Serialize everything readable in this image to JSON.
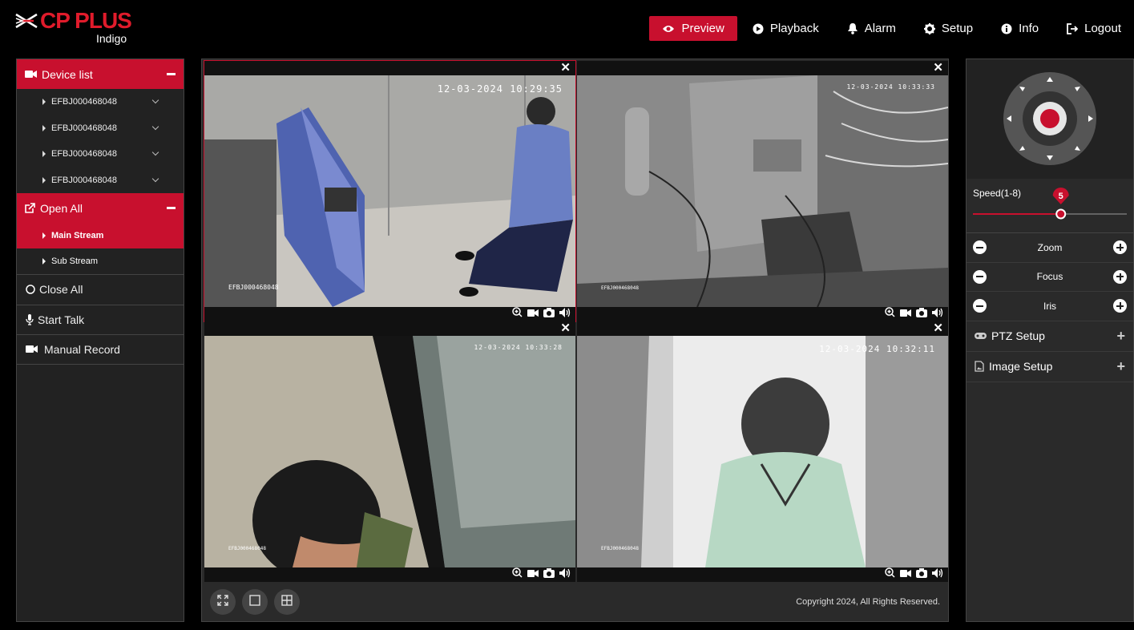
{
  "brand": {
    "name": "CP PLUS",
    "sub": "Indigo"
  },
  "nav": [
    {
      "label": "Preview",
      "icon": "eye-icon",
      "active": true
    },
    {
      "label": "Playback",
      "icon": "play-circle-icon"
    },
    {
      "label": "Alarm",
      "icon": "bell-icon"
    },
    {
      "label": "Setup",
      "icon": "gear-icon"
    },
    {
      "label": "Info",
      "icon": "info-icon"
    },
    {
      "label": "Logout",
      "icon": "logout-icon"
    }
  ],
  "sidebar": {
    "device_list_label": "Device list",
    "devices": [
      "EFBJ000468048",
      "EFBJ000468048",
      "EFBJ000468048",
      "EFBJ000468048"
    ],
    "open_all_label": "Open All",
    "streams": [
      {
        "label": "Main Stream",
        "active": true
      },
      {
        "label": "Sub Stream",
        "active": false
      }
    ],
    "close_all_label": "Close All",
    "start_talk_label": "Start Talk",
    "manual_record_label": "Manual Record"
  },
  "tiles": [
    {
      "timestamp": "12-03-2024 10:29:35",
      "camera_label": "EFBJ000468048",
      "selected": true
    },
    {
      "timestamp": "12-03-2024 10:33:33",
      "camera_label": "EFBJ000468048"
    },
    {
      "timestamp": "12-03-2024 10:33:28",
      "camera_label": "EFBJ000468048"
    },
    {
      "timestamp": "12-03-2024 10:32:11",
      "camera_label": "EFBJ000468048"
    }
  ],
  "footer": {
    "copyright": "Copyright 2024, All Rights Reserved."
  },
  "ptz": {
    "speed_label": "Speed(1-8)",
    "speed_value": "5",
    "speed_min": 1,
    "speed_max": 8,
    "zoom_label": "Zoom",
    "focus_label": "Focus",
    "iris_label": "Iris",
    "ptz_setup_label": "PTZ Setup",
    "image_setup_label": "Image Setup"
  },
  "colors": {
    "accent": "#c8102e",
    "panel": "#222222"
  }
}
